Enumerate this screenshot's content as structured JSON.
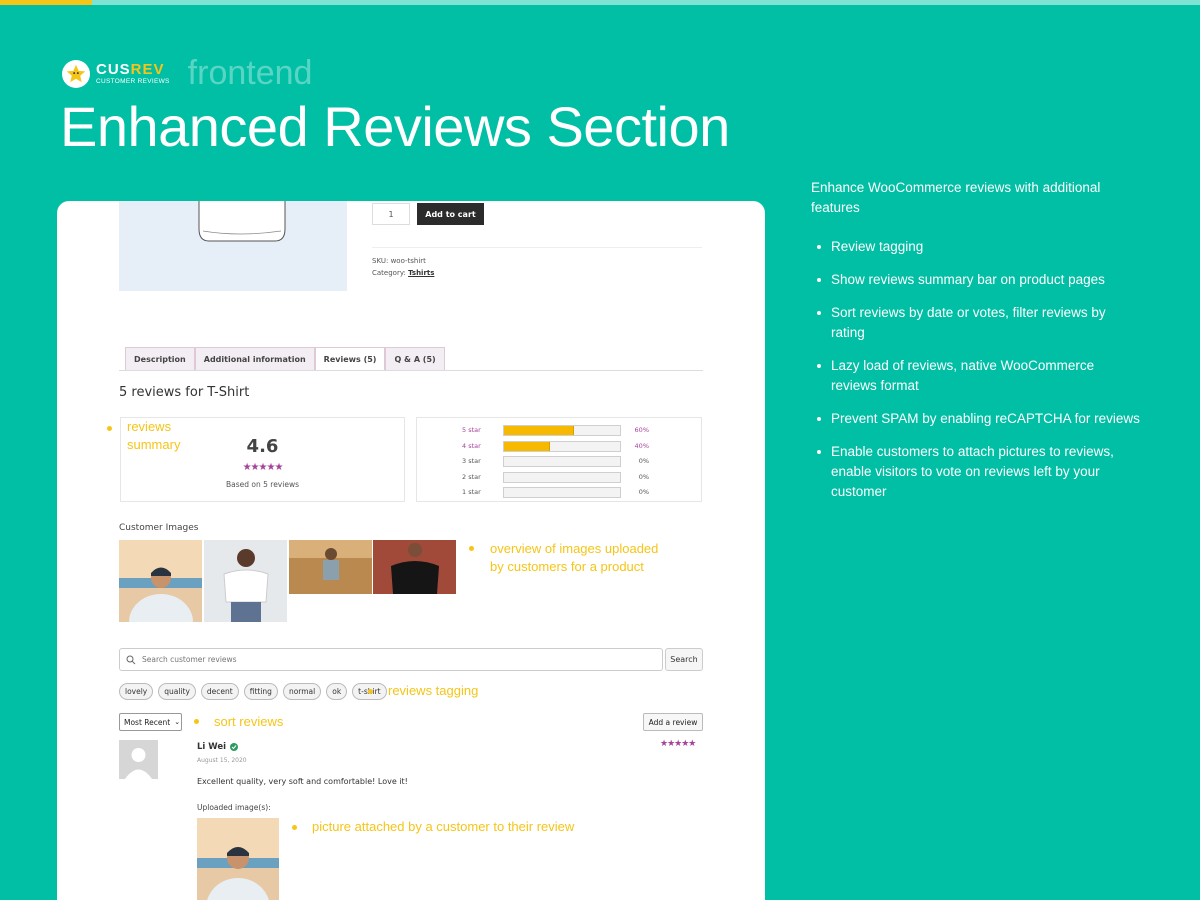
{
  "brand": {
    "name_a": "CUS",
    "name_b": "REV",
    "subtitle": "CUSTOMER REVIEWS",
    "tag": "frontend"
  },
  "headline": "Enhanced Reviews Section",
  "features": {
    "intro": "Enhance WooCommerce reviews with additional features",
    "items": [
      "Review tagging",
      "Show reviews summary bar on product pages",
      "Sort reviews by date or votes, filter reviews by rating",
      "Lazy load of reviews, native WooCommerce reviews format",
      "Prevent SPAM by enabling reCAPTCHA for reviews",
      "Enable customers to attach pictures to reviews, enable visitors to vote on reviews left by your customer"
    ]
  },
  "product": {
    "qty": "1",
    "add_to_cart": "Add to cart",
    "sku_label": "SKU:",
    "sku": "woo-tshirt",
    "category_label": "Category:",
    "category": "Tshirts"
  },
  "tabs": [
    "Description",
    "Additional information",
    "Reviews (5)",
    "Q & A (5)"
  ],
  "reviews_title": "5 reviews for T-Shirt",
  "summary": {
    "average": "4.6",
    "stars": "★★★★★",
    "rating_fraction": 0.92,
    "based_on": "Based on 5 reviews",
    "bars": [
      {
        "label": "5 star",
        "percent": 60,
        "pct_text": "60%",
        "highlight": true
      },
      {
        "label": "4 star",
        "percent": 40,
        "pct_text": "40%",
        "highlight": true
      },
      {
        "label": "3 star",
        "percent": 0,
        "pct_text": "0%",
        "highlight": false
      },
      {
        "label": "2 star",
        "percent": 0,
        "pct_text": "0%",
        "highlight": false
      },
      {
        "label": "1 star",
        "percent": 0,
        "pct_text": "0%",
        "highlight": false
      }
    ]
  },
  "customer_images_label": "Customer Images",
  "search": {
    "placeholder": "Search customer reviews",
    "button": "Search"
  },
  "tags": [
    "lovely",
    "quality",
    "decent",
    "fitting",
    "normal",
    "ok",
    "t-shirt"
  ],
  "sort": {
    "selected": "Most Recent"
  },
  "add_review": "Add a review",
  "review": {
    "author": "Li Wei",
    "date": "August 15, 2020",
    "stars": "★★★★★",
    "text": "Excellent quality, very soft and comfortable! Love it!",
    "uploaded_label": "Uploaded image(s):"
  },
  "annotations": {
    "summary_line1": "reviews",
    "summary_line2": "summary",
    "images_line1": "overview of images uploaded",
    "images_line2": "by customers for a product",
    "tagging": "reviews tagging",
    "sort": "sort reviews",
    "picture": "picture attached by a customer to their review"
  },
  "colors": {
    "background": "#00bfa5",
    "accent": "#f5c518",
    "star": "#a6429a",
    "bar": "#f7b900"
  }
}
